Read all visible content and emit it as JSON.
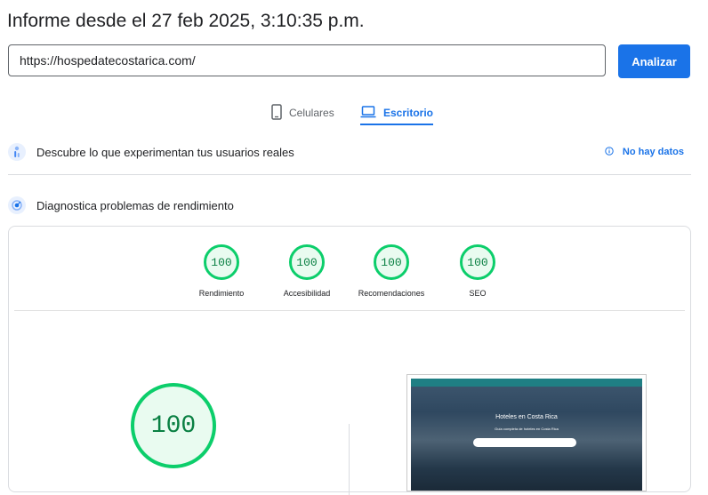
{
  "header": {
    "title": "Informe desde el 27 feb 2025, 3:10:35 p.m."
  },
  "search": {
    "url_value": "https://hospedatecostarica.com/",
    "analyze_label": "Analizar"
  },
  "tabs": [
    {
      "label": "Celulares",
      "icon": "smartphone-icon",
      "selected": false
    },
    {
      "label": "Escritorio",
      "icon": "laptop-icon",
      "selected": true
    }
  ],
  "field_data": {
    "label": "Descubre lo que experimentan tus usuarios reales",
    "status": "No hay datos",
    "status_icon": "info-icon"
  },
  "lab_data": {
    "label": "Diagnostica problemas de rendimiento"
  },
  "scores": [
    {
      "label": "Rendimiento",
      "value": "100"
    },
    {
      "label": "Accesibilidad",
      "value": "100"
    },
    {
      "label": "Recomendaciones",
      "value": "100"
    },
    {
      "label": "SEO",
      "value": "100"
    }
  ],
  "main_score": "100",
  "colors": {
    "accent": "#1a73e8",
    "pass": "#0cce6b",
    "pass_text": "#0a8043"
  }
}
